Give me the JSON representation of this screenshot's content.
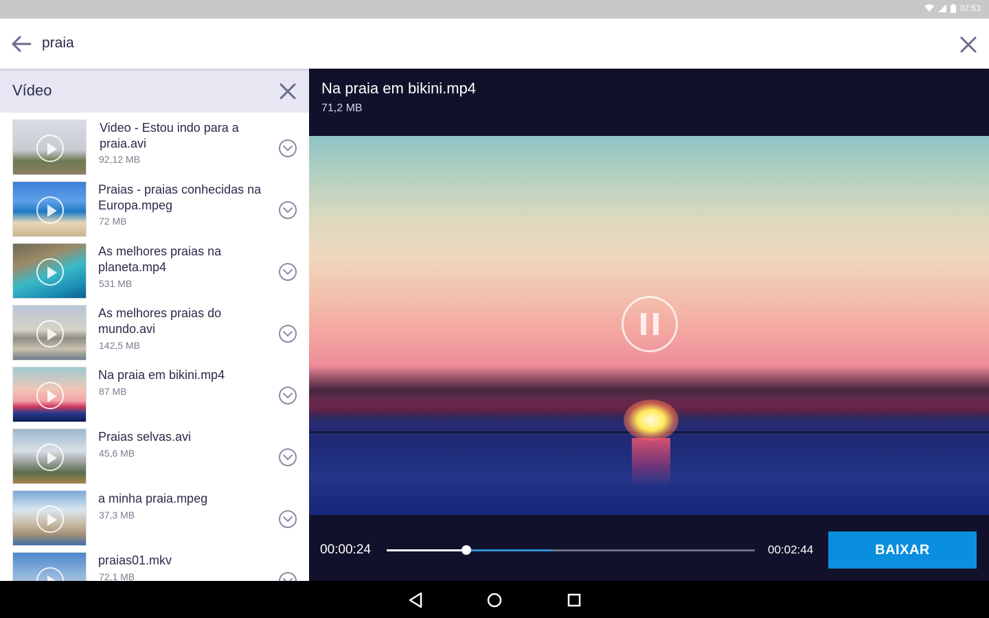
{
  "status_bar": {
    "time": "07:53"
  },
  "search": {
    "query": "praia"
  },
  "filter": {
    "title": "Vídeo"
  },
  "videos": [
    {
      "title": "Video - Estou indo para a praia.avi",
      "size": "92,12 MB"
    },
    {
      "title": "Praias - praias conhecidas na Europa.mpeg",
      "size": "72 MB"
    },
    {
      "title": "As melhores praias na planeta.mp4",
      "size": "531 MB"
    },
    {
      "title": "As melhores praias do mundo.avi",
      "size": "142,5 MB"
    },
    {
      "title": "Na praia em bikini.mp4",
      "size": "87 MB"
    },
    {
      "title": "Praias selvas.avi",
      "size": "45,6 MB"
    },
    {
      "title": "a minha praia.mpeg",
      "size": "37,3 MB"
    },
    {
      "title": "praias01.mkv",
      "size": "72,1 MB"
    }
  ],
  "player": {
    "title": "Na praia em bikini.mp4",
    "size": "71,2 MB",
    "current_time": "00:00:24",
    "total_time": "00:02:44",
    "played_fraction": 0.217,
    "buffered_fraction": 0.45,
    "download_label": "BAIXAR"
  },
  "colors": {
    "accent": "#0a8fdf",
    "player_bg": "#12112b",
    "filter_bg": "#e7e7f4",
    "text": "#2b2b4a"
  }
}
